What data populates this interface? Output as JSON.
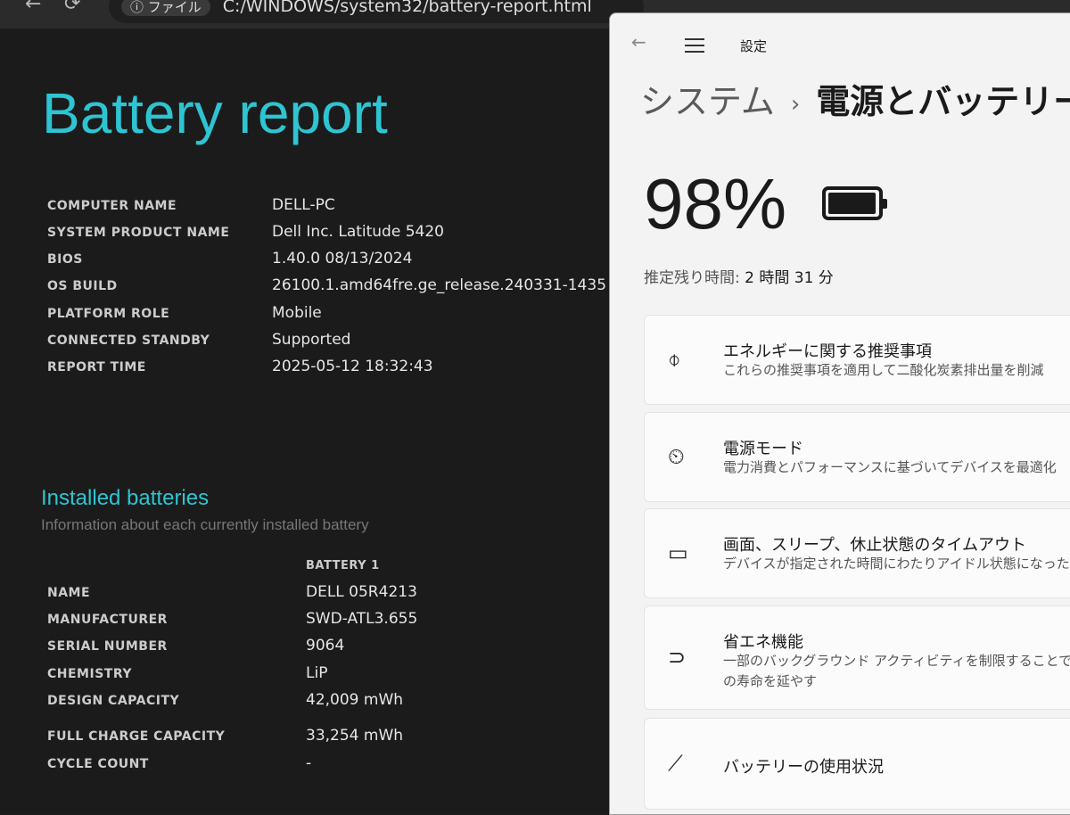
{
  "browser": {
    "back": "←",
    "refresh": "⟳",
    "address_chip": "ⓘ ファイル",
    "address": "C:/WINDOWS/system32/battery-report.html"
  },
  "report": {
    "title": "Battery report",
    "system": [
      {
        "k": "COMPUTER NAME",
        "v": "DELL-PC"
      },
      {
        "k": "SYSTEM PRODUCT NAME",
        "v": "Dell Inc. Latitude 5420"
      },
      {
        "k": "BIOS",
        "v": "1.40.0 08/13/2024"
      },
      {
        "k": "OS BUILD",
        "v": "26100.1.amd64fre.ge_release.240331-1435"
      },
      {
        "k": "PLATFORM ROLE",
        "v": "Mobile"
      },
      {
        "k": "CONNECTED STANDBY",
        "v": "Supported"
      },
      {
        "k": "REPORT TIME",
        "v": "2025-05-12  18:32:43"
      }
    ],
    "installed_title": "Installed batteries",
    "installed_sub": "Information about each currently installed battery",
    "battery_header": "BATTERY 1",
    "battery": [
      {
        "k": "NAME",
        "v": "DELL 05R4213"
      },
      {
        "k": "MANUFACTURER",
        "v": "SWD-ATL3.655"
      },
      {
        "k": "SERIAL NUMBER",
        "v": "9064"
      },
      {
        "k": "CHEMISTRY",
        "v": "LiP"
      },
      {
        "k": "DESIGN CAPACITY",
        "v": "42,009 mWh"
      },
      {
        "k": "FULL CHARGE CAPACITY",
        "v": "33,254 mWh"
      },
      {
        "k": "CYCLE COUNT",
        "v": "-"
      }
    ]
  },
  "settings": {
    "app_title": "設定",
    "back": "←",
    "breadcrumb_parent": "システム",
    "breadcrumb_sep": "›",
    "breadcrumb_current": "電源とバッテリー",
    "battery_percent": "98%",
    "battery_level": 0.98,
    "estimate_label": "推定残り時間:",
    "estimate_value": "2 時間 31 分",
    "cards": [
      {
        "icon": "leaf-icon",
        "glyph": "⌽",
        "title": "エネルギーに関する推奨事項",
        "desc": "これらの推奨事項を適用して二酸化炭素排出量を削減"
      },
      {
        "icon": "gauge-icon",
        "glyph": "⏲",
        "title": "電源モード",
        "desc": "電力消費とパフォーマンスに基づいてデバイスを最適化"
      },
      {
        "icon": "screen-sleep-icon",
        "glyph": "▭",
        "title": "画面、スリープ、休止状態のタイムアウト",
        "desc": "デバイスが指定された時間にわたりアイドル状態になった場"
      },
      {
        "icon": "battery-saver-icon",
        "glyph": "⊃",
        "title": "省エネ機能",
        "desc": "一部のバックグラウンド アクティビティを制限することで、電",
        "desc2": "の寿命を延やす"
      },
      {
        "icon": "chart-icon",
        "glyph": "⟋",
        "title": "バッテリーの使用状況"
      }
    ]
  }
}
